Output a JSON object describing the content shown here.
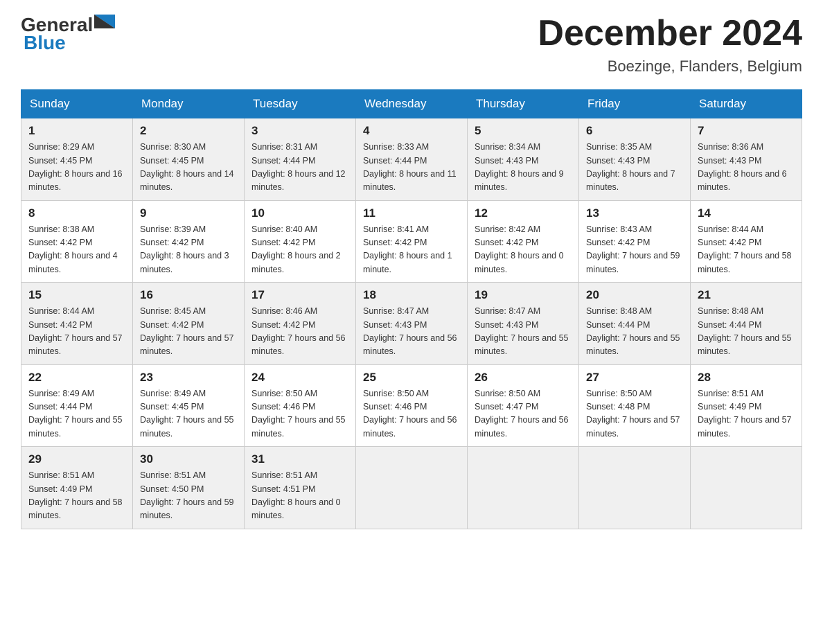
{
  "header": {
    "logo": {
      "general": "General",
      "blue": "Blue"
    },
    "title": "December 2024",
    "location": "Boezinge, Flanders, Belgium"
  },
  "columns": [
    "Sunday",
    "Monday",
    "Tuesday",
    "Wednesday",
    "Thursday",
    "Friday",
    "Saturday"
  ],
  "weeks": [
    [
      {
        "day": "1",
        "sunrise": "8:29 AM",
        "sunset": "4:45 PM",
        "daylight": "8 hours and 16 minutes."
      },
      {
        "day": "2",
        "sunrise": "8:30 AM",
        "sunset": "4:45 PM",
        "daylight": "8 hours and 14 minutes."
      },
      {
        "day": "3",
        "sunrise": "8:31 AM",
        "sunset": "4:44 PM",
        "daylight": "8 hours and 12 minutes."
      },
      {
        "day": "4",
        "sunrise": "8:33 AM",
        "sunset": "4:44 PM",
        "daylight": "8 hours and 11 minutes."
      },
      {
        "day": "5",
        "sunrise": "8:34 AM",
        "sunset": "4:43 PM",
        "daylight": "8 hours and 9 minutes."
      },
      {
        "day": "6",
        "sunrise": "8:35 AM",
        "sunset": "4:43 PM",
        "daylight": "8 hours and 7 minutes."
      },
      {
        "day": "7",
        "sunrise": "8:36 AM",
        "sunset": "4:43 PM",
        "daylight": "8 hours and 6 minutes."
      }
    ],
    [
      {
        "day": "8",
        "sunrise": "8:38 AM",
        "sunset": "4:42 PM",
        "daylight": "8 hours and 4 minutes."
      },
      {
        "day": "9",
        "sunrise": "8:39 AM",
        "sunset": "4:42 PM",
        "daylight": "8 hours and 3 minutes."
      },
      {
        "day": "10",
        "sunrise": "8:40 AM",
        "sunset": "4:42 PM",
        "daylight": "8 hours and 2 minutes."
      },
      {
        "day": "11",
        "sunrise": "8:41 AM",
        "sunset": "4:42 PM",
        "daylight": "8 hours and 1 minute."
      },
      {
        "day": "12",
        "sunrise": "8:42 AM",
        "sunset": "4:42 PM",
        "daylight": "8 hours and 0 minutes."
      },
      {
        "day": "13",
        "sunrise": "8:43 AM",
        "sunset": "4:42 PM",
        "daylight": "7 hours and 59 minutes."
      },
      {
        "day": "14",
        "sunrise": "8:44 AM",
        "sunset": "4:42 PM",
        "daylight": "7 hours and 58 minutes."
      }
    ],
    [
      {
        "day": "15",
        "sunrise": "8:44 AM",
        "sunset": "4:42 PM",
        "daylight": "7 hours and 57 minutes."
      },
      {
        "day": "16",
        "sunrise": "8:45 AM",
        "sunset": "4:42 PM",
        "daylight": "7 hours and 57 minutes."
      },
      {
        "day": "17",
        "sunrise": "8:46 AM",
        "sunset": "4:42 PM",
        "daylight": "7 hours and 56 minutes."
      },
      {
        "day": "18",
        "sunrise": "8:47 AM",
        "sunset": "4:43 PM",
        "daylight": "7 hours and 56 minutes."
      },
      {
        "day": "19",
        "sunrise": "8:47 AM",
        "sunset": "4:43 PM",
        "daylight": "7 hours and 55 minutes."
      },
      {
        "day": "20",
        "sunrise": "8:48 AM",
        "sunset": "4:44 PM",
        "daylight": "7 hours and 55 minutes."
      },
      {
        "day": "21",
        "sunrise": "8:48 AM",
        "sunset": "4:44 PM",
        "daylight": "7 hours and 55 minutes."
      }
    ],
    [
      {
        "day": "22",
        "sunrise": "8:49 AM",
        "sunset": "4:44 PM",
        "daylight": "7 hours and 55 minutes."
      },
      {
        "day": "23",
        "sunrise": "8:49 AM",
        "sunset": "4:45 PM",
        "daylight": "7 hours and 55 minutes."
      },
      {
        "day": "24",
        "sunrise": "8:50 AM",
        "sunset": "4:46 PM",
        "daylight": "7 hours and 55 minutes."
      },
      {
        "day": "25",
        "sunrise": "8:50 AM",
        "sunset": "4:46 PM",
        "daylight": "7 hours and 56 minutes."
      },
      {
        "day": "26",
        "sunrise": "8:50 AM",
        "sunset": "4:47 PM",
        "daylight": "7 hours and 56 minutes."
      },
      {
        "day": "27",
        "sunrise": "8:50 AM",
        "sunset": "4:48 PM",
        "daylight": "7 hours and 57 minutes."
      },
      {
        "day": "28",
        "sunrise": "8:51 AM",
        "sunset": "4:49 PM",
        "daylight": "7 hours and 57 minutes."
      }
    ],
    [
      {
        "day": "29",
        "sunrise": "8:51 AM",
        "sunset": "4:49 PM",
        "daylight": "7 hours and 58 minutes."
      },
      {
        "day": "30",
        "sunrise": "8:51 AM",
        "sunset": "4:50 PM",
        "daylight": "7 hours and 59 minutes."
      },
      {
        "day": "31",
        "sunrise": "8:51 AM",
        "sunset": "4:51 PM",
        "daylight": "8 hours and 0 minutes."
      },
      null,
      null,
      null,
      null
    ]
  ]
}
